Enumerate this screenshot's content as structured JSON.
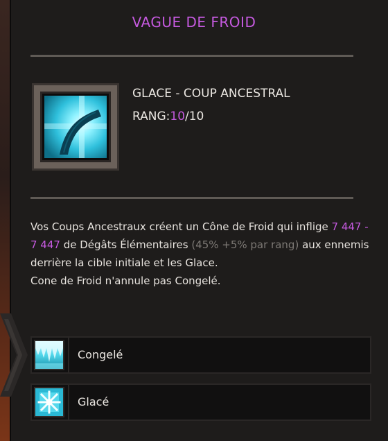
{
  "tooltip": {
    "title": "VAGUE DE FROID",
    "skill": {
      "name": "GLACE - COUP ANCESTRAL",
      "rank_label": "RANG:",
      "rank_current": "10",
      "rank_max": "/10",
      "icon": "ice-ancestral-strike-icon"
    },
    "description": {
      "part1": "Vos Coups Ancestraux créent un Cône de Froid qui inflige ",
      "damage": "7 447 - 7 447",
      "part2": " de Dégâts Élémentaires ",
      "scaling": "(45% +5% par rang)",
      "part3": " aux ennemis derrière la cible initiale et les Glace.",
      "line2": "Cone de Froid n'annule pas Congelé."
    },
    "effects": [
      {
        "label": "Congelé",
        "icon": "frozen-icon"
      },
      {
        "label": "Glacé",
        "icon": "snowflake-icon"
      }
    ]
  },
  "colors": {
    "accent": "#c65ae0",
    "text": "#ebe7e2",
    "dim_text": "#7d7975",
    "panel_bg": "#1e1c1b",
    "ice": "#3fd0e6"
  }
}
